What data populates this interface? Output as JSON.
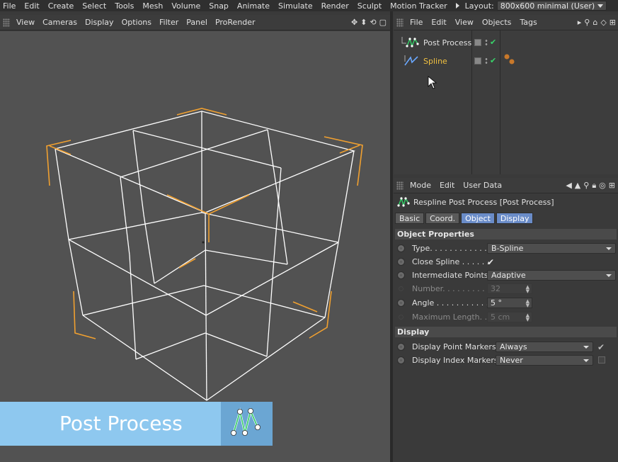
{
  "top_menu": {
    "items": [
      "File",
      "Edit",
      "Create",
      "Select",
      "Tools",
      "Mesh",
      "Volume",
      "Snap",
      "Animate",
      "Simulate",
      "Render",
      "Sculpt",
      "Motion Tracker"
    ],
    "layout_label": "Layout:",
    "layout_value": "800x600 minimal (User)"
  },
  "viewport_menu": {
    "items": [
      "View",
      "Cameras",
      "Display",
      "Options",
      "Filter",
      "Panel",
      "ProRender"
    ]
  },
  "banner": {
    "title": "Post Process"
  },
  "object_manager": {
    "menu": [
      "File",
      "Edit",
      "View",
      "Objects",
      "Tags"
    ],
    "objects": [
      {
        "name": "Post Process",
        "color": "#e0e0e0"
      },
      {
        "name": "Spline",
        "color": "#f0c040"
      }
    ]
  },
  "attribute_manager": {
    "menu": [
      "Mode",
      "Edit",
      "User Data"
    ],
    "title": "Respline Post Process [Post Process]",
    "tabs": [
      {
        "label": "Basic",
        "active": false
      },
      {
        "label": "Coord.",
        "active": false
      },
      {
        "label": "Object",
        "active": true
      },
      {
        "label": "Display",
        "active": true
      }
    ],
    "section_object": "Object Properties",
    "props": {
      "type_label": "Type. . . . . . . . . . . . . .",
      "type_value": "B-Spline",
      "close_label": "Close Spline . . . . . .",
      "close_check": "✔",
      "inter_label": "Intermediate Points",
      "inter_value": "Adaptive",
      "number_label": "Number. . . . . . . . . .",
      "number_value": "32",
      "angle_label": "Angle . . . . . . . . . . .",
      "angle_value": "5 °",
      "maxlen_label": "Maximum Length. . .",
      "maxlen_value": "5 cm"
    },
    "section_display": "Display",
    "display_props": {
      "point_label": "Display Point Markers",
      "point_value": "Always",
      "point_check": "✔",
      "index_label": "Display Index Markers",
      "index_value": "Never"
    }
  },
  "colors": {
    "selection_orange": "#f0a030",
    "wire_white": "#ffffff",
    "banner_blue": "#8ec8ef",
    "active_tab": "#6a8cc8"
  }
}
